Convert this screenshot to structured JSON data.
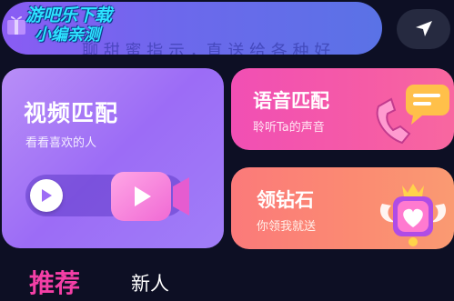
{
  "banner": {
    "watermark_line1": "游吧乐下载",
    "watermark_line2": "小编亲测",
    "marquee": "聊 甜 蜜 指 示 ，直 送 给 各 种 好",
    "icon": "gift-icon"
  },
  "nav": {
    "icon": "location-arrow-icon"
  },
  "video_card": {
    "title": "视频匹配",
    "subtitle": "看看喜欢的人",
    "icons": [
      "play-icon",
      "video-camera-icon"
    ]
  },
  "voice_card": {
    "title": "语音匹配",
    "subtitle": "聆听Ta的声音",
    "icon": "phone-chat-icon"
  },
  "diamond_card": {
    "title": "领钻石",
    "subtitle": "你领我就送",
    "icon": "winged-heart-badge-icon"
  },
  "tabs": [
    {
      "label": "推荐",
      "active": true
    },
    {
      "label": "新人",
      "active": false
    }
  ],
  "colors": {
    "background": "#0d0f24",
    "accent_pink": "#f43fa6",
    "video_card": "#9c6cf6",
    "voice_card": "#f55ba6",
    "diamond_card": "#fb8a72"
  }
}
